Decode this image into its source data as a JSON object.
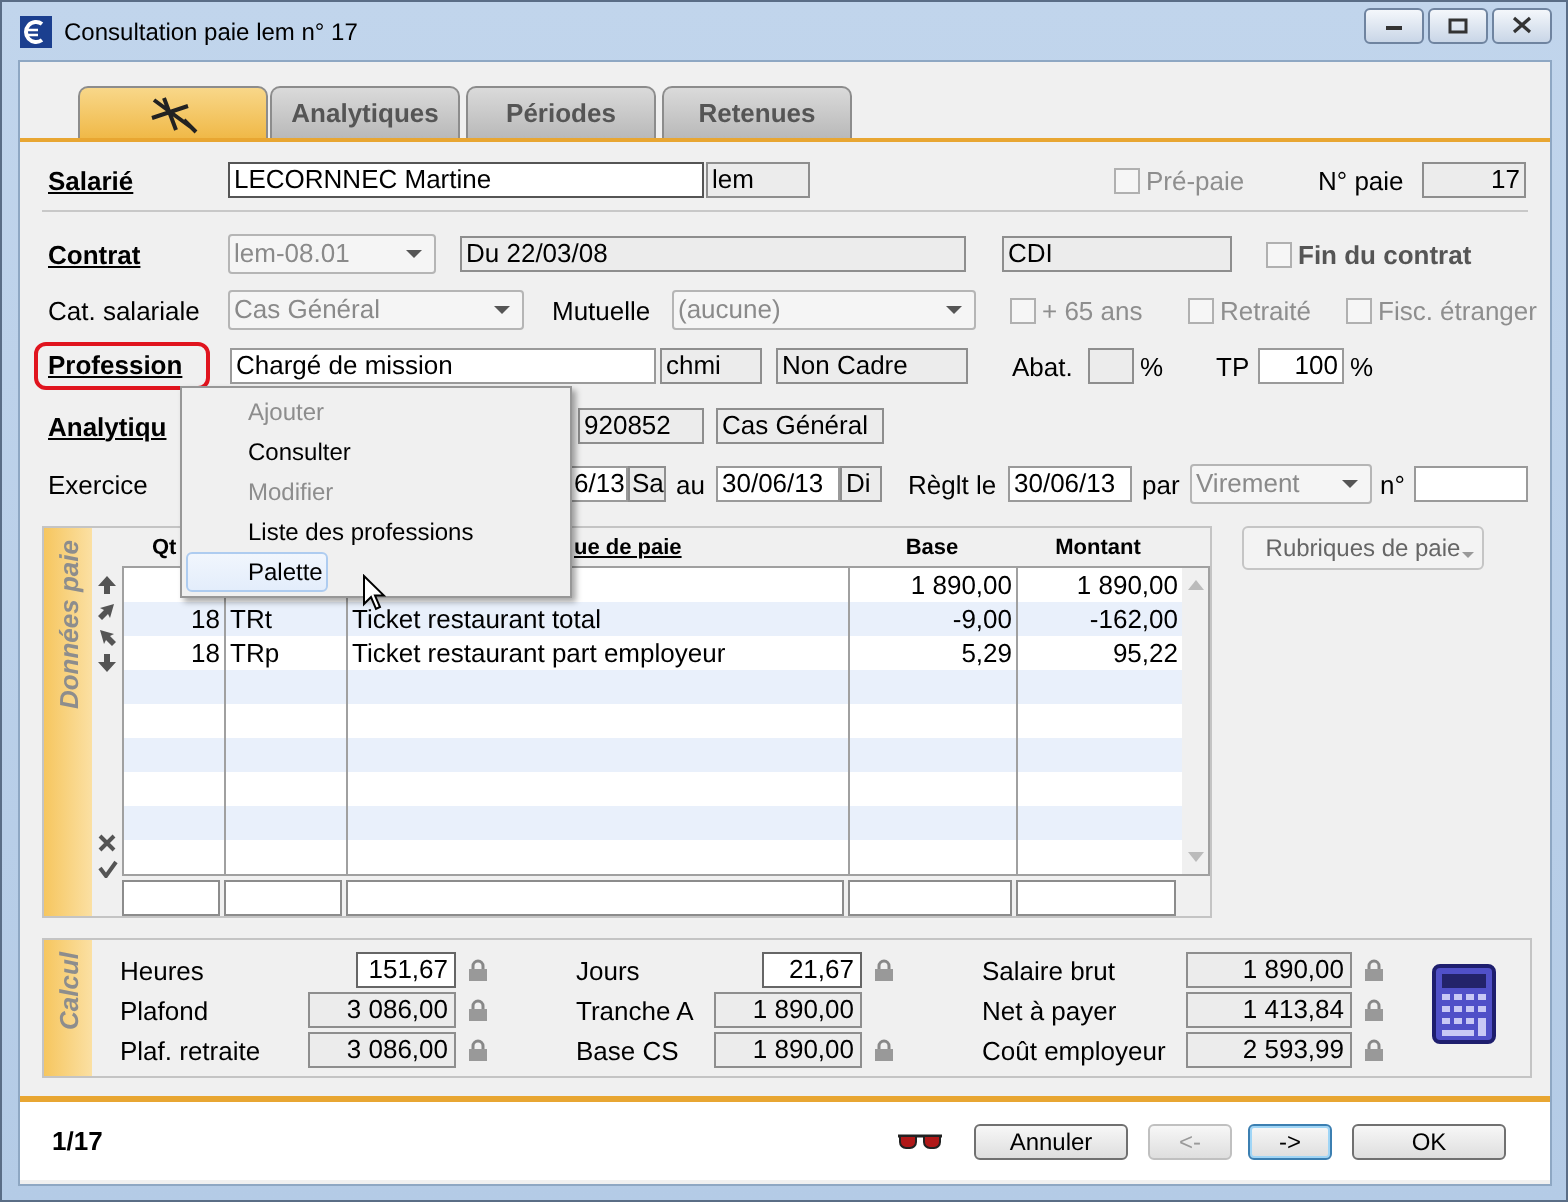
{
  "window": {
    "title": "Consultation paie lem n° 17"
  },
  "tabs": [
    {
      "kind": "icon",
      "selected": true
    },
    {
      "kind": "text",
      "label": "Analytiques",
      "selected": false
    },
    {
      "kind": "text",
      "label": "Périodes",
      "selected": false
    },
    {
      "kind": "text",
      "label": "Retenues",
      "selected": false
    }
  ],
  "salarie": {
    "label": "Salarié",
    "name": "LECORNNEC Martine",
    "code": "lem",
    "pre_paie": {
      "label": "Pré-paie",
      "checked": false,
      "disabled": true
    },
    "number_label": "N° paie",
    "number": "17"
  },
  "contrat": {
    "label": "Contrat",
    "select": {
      "value": "lem-08.01",
      "disabled": true
    },
    "period": "Du 22/03/08",
    "type": "CDI",
    "end": {
      "label": "Fin du contrat",
      "checked": false,
      "disabled": false
    }
  },
  "categorie": {
    "label": "Cat. salariale",
    "select": {
      "value": "Cas Général",
      "disabled": true
    },
    "mutuelle_label": "Mutuelle",
    "mutuelle": {
      "value": "(aucune)",
      "disabled": true
    },
    "checkboxes": [
      {
        "label": "+ 65 ans",
        "checked": false,
        "disabled": true
      },
      {
        "label": "Retraité",
        "checked": false,
        "disabled": true
      },
      {
        "label": "Fisc. étranger",
        "checked": false,
        "disabled": true
      }
    ]
  },
  "profession": {
    "label": "Profession",
    "highlighted": true,
    "name": "Chargé de mission",
    "code": "chmi",
    "status": "Non Cadre",
    "abat_label": "Abat.",
    "abat_unit": "%",
    "tp_label": "TP",
    "tp": "100",
    "tp_unit": "%"
  },
  "analytique": {
    "label": "Analytiqu",
    "code": "920852",
    "category": "Cas Général"
  },
  "exercice": {
    "label": "Exercice",
    "start": "6/13",
    "start_day": "Sa",
    "to_label": "au",
    "end": "30/06/13",
    "end_day": "Di",
    "payment_label": "Règlt le",
    "payment_date": "30/06/13",
    "by_label": "par",
    "method": {
      "value": "Virement",
      "disabled": true
    },
    "number_label": "n°"
  },
  "grid": {
    "label": "Données paie",
    "headers": {
      "qty": "Qt",
      "label": "ue de paie",
      "base": "Base",
      "amount": "Montant"
    },
    "rows": [
      {
        "base": "1 890,00",
        "amount": "1 890,00"
      },
      {
        "qty": "18",
        "code": "TRt",
        "label": "Ticket restaurant total",
        "base": "-9,00",
        "amount": "-162,00"
      },
      {
        "qty": "18",
        "code": "TRp",
        "label": "Ticket restaurant part employeur",
        "base": "5,29",
        "amount": "95,22"
      }
    ]
  },
  "rubriques_button": {
    "label": "Rubriques de paie"
  },
  "calcul": {
    "label": "Calcul",
    "columns": [
      [
        {
          "label": "Heures",
          "value": "151,67",
          "editable": true,
          "locked": true
        },
        {
          "label": "Plafond",
          "value": "3 086,00",
          "editable": false,
          "locked": true
        },
        {
          "label": "Plaf. retraite",
          "value": "3 086,00",
          "editable": false,
          "locked": true
        }
      ],
      [
        {
          "label": "Jours",
          "value": "21,67",
          "editable": true,
          "locked": true
        },
        {
          "label": "Tranche A",
          "value": "1 890,00",
          "editable": false,
          "locked": false
        },
        {
          "label": "Base CS",
          "value": "1 890,00",
          "editable": false,
          "locked": true
        }
      ],
      [
        {
          "label": "Salaire brut",
          "value": "1 890,00",
          "editable": false,
          "locked": true
        },
        {
          "label": "Net à payer",
          "value": "1 413,84",
          "editable": false,
          "locked": true
        },
        {
          "label": "Coût employeur",
          "value": "2 593,99",
          "editable": false,
          "locked": true
        }
      ]
    ]
  },
  "context_menu": {
    "items": [
      {
        "label": "Ajouter",
        "disabled": true,
        "selected": false
      },
      {
        "label": "Consulter",
        "disabled": false,
        "selected": false
      },
      {
        "label": "Modifier",
        "disabled": true,
        "selected": false
      },
      {
        "label": "Liste des professions",
        "disabled": false,
        "selected": false
      },
      {
        "label": "Palette",
        "disabled": false,
        "selected": true
      }
    ]
  },
  "footer": {
    "position": "1/17",
    "buttons": [
      {
        "label": "Annuler",
        "disabled": false,
        "default": false
      },
      {
        "label": "<-",
        "disabled": true,
        "default": false
      },
      {
        "label": "->",
        "disabled": false,
        "default": true
      },
      {
        "label": "OK",
        "disabled": false,
        "default": false
      }
    ]
  }
}
